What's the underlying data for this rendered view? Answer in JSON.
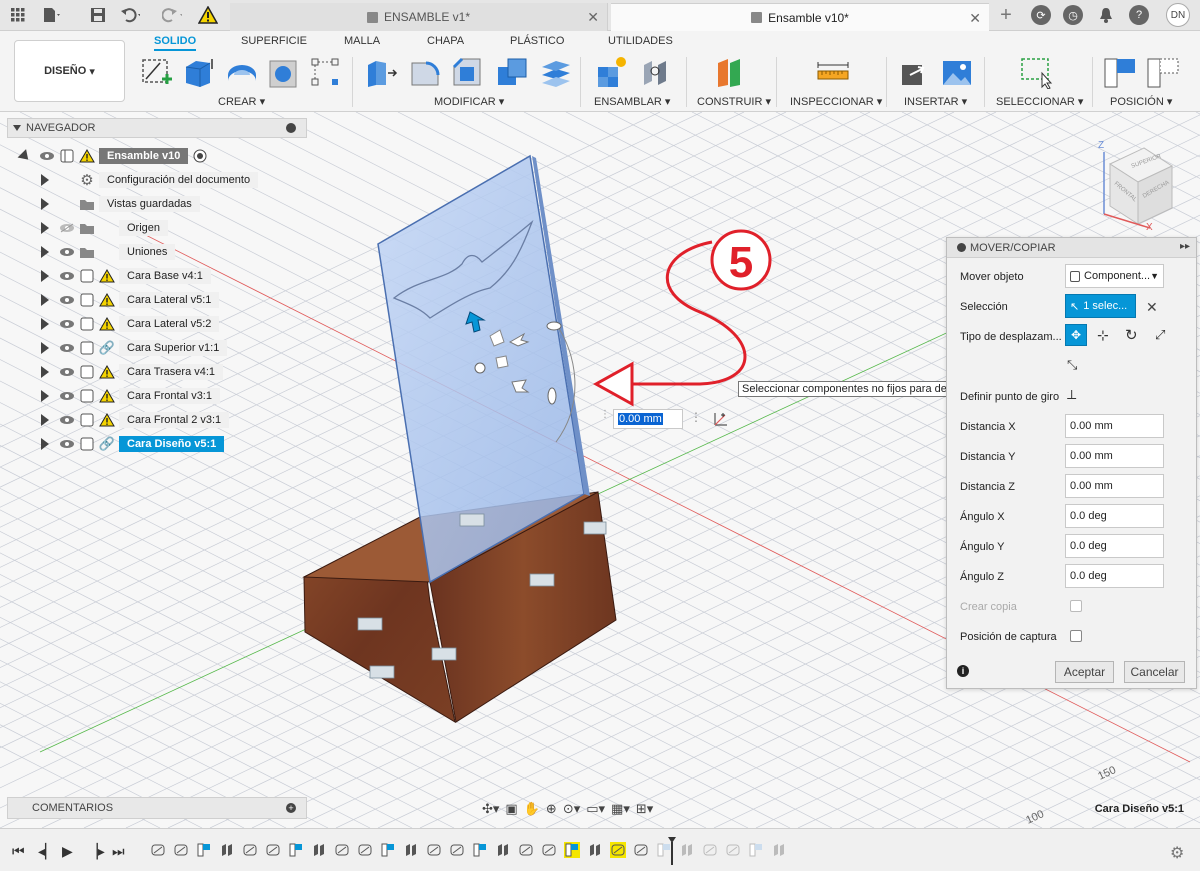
{
  "app": {
    "tabs": [
      {
        "label": "ENSAMBLE v1*",
        "active": false
      },
      {
        "label": "Ensamble v10*",
        "active": true
      }
    ],
    "user_initials": "DN"
  },
  "toolbar": {
    "workspace": "DISEÑO",
    "ribbon_tabs": [
      "SOLIDO",
      "SUPERFICIE",
      "MALLA",
      "CHAPA",
      "PLÁSTICO",
      "UTILIDADES"
    ],
    "active_tab": "SOLIDO",
    "groups": [
      "CREAR",
      "MODIFICAR",
      "ENSAMBLAR",
      "CONSTRUIR",
      "INSPECCIONAR",
      "INSERTAR",
      "SELECCIONAR",
      "POSICIÓN"
    ]
  },
  "navigator": {
    "title": "NAVEGADOR",
    "root": "Ensamble v10",
    "items": [
      {
        "label": "Configuración del documento",
        "icon": "gear-icon",
        "warning": false
      },
      {
        "label": "Vistas guardadas",
        "icon": "folder-icon",
        "warning": false
      },
      {
        "label": "Origen",
        "icon": "folder-icon",
        "warning": false
      },
      {
        "label": "Uniones",
        "icon": "folder-icon",
        "warning": false
      },
      {
        "label": "Cara Base v4:1",
        "icon": "component-icon",
        "warning": true
      },
      {
        "label": "Cara Lateral v5:1",
        "icon": "component-icon",
        "warning": true
      },
      {
        "label": "Cara Lateral v5:2",
        "icon": "component-icon",
        "warning": true
      },
      {
        "label": "Cara Superior v1:1",
        "icon": "link-icon",
        "warning": false
      },
      {
        "label": "Cara Trasera v4:1",
        "icon": "component-icon",
        "warning": true
      },
      {
        "label": "Cara Frontal v3:1",
        "icon": "component-icon",
        "warning": true
      },
      {
        "label": "Cara Frontal 2 v3:1",
        "icon": "component-icon",
        "warning": true
      },
      {
        "label": "Cara Diseño v5:1",
        "icon": "link-icon",
        "warning": false,
        "selected": true
      }
    ]
  },
  "annotation": {
    "number": "5"
  },
  "tooltip": "Seleccionar componentes no fijos para desplazarlos",
  "viewport": {
    "distance_value": "0.00 mm",
    "selected_component": "Cara Diseño v5:1"
  },
  "viewcube": {
    "top": "SUPERIOR",
    "front": "FRONTAL",
    "right": "DERECHA",
    "z": "Z",
    "x": "X"
  },
  "grid_labels": [
    "150",
    "100"
  ],
  "move_panel": {
    "title": "MOVER/COPIAR",
    "mover_objeto_label": "Mover objeto",
    "mover_objeto_value": "Component...",
    "seleccion_label": "Selección",
    "seleccion_value": "1 selec...",
    "tipo_label": "Tipo de desplazam...",
    "giro_label": "Definir punto de giro",
    "fields": [
      {
        "label": "Distancia X",
        "value": "0.00 mm"
      },
      {
        "label": "Distancia Y",
        "value": "0.00 mm"
      },
      {
        "label": "Distancia Z",
        "value": "0.00 mm"
      },
      {
        "label": "Ángulo X",
        "value": "0.0 deg"
      },
      {
        "label": "Ángulo Y",
        "value": "0.0 deg"
      },
      {
        "label": "Ángulo Z",
        "value": "0.0 deg"
      }
    ],
    "crear_copia": "Crear copia",
    "posicion_captura": "Posición de captura",
    "accept": "Aceptar",
    "cancel": "Cancelar"
  },
  "comments": {
    "title": "COMENTARIOS"
  },
  "colors": {
    "accent": "#0696d7",
    "wood": "#7a3f24",
    "glass": "#a8c4ee",
    "annotation": "#e0202a"
  }
}
